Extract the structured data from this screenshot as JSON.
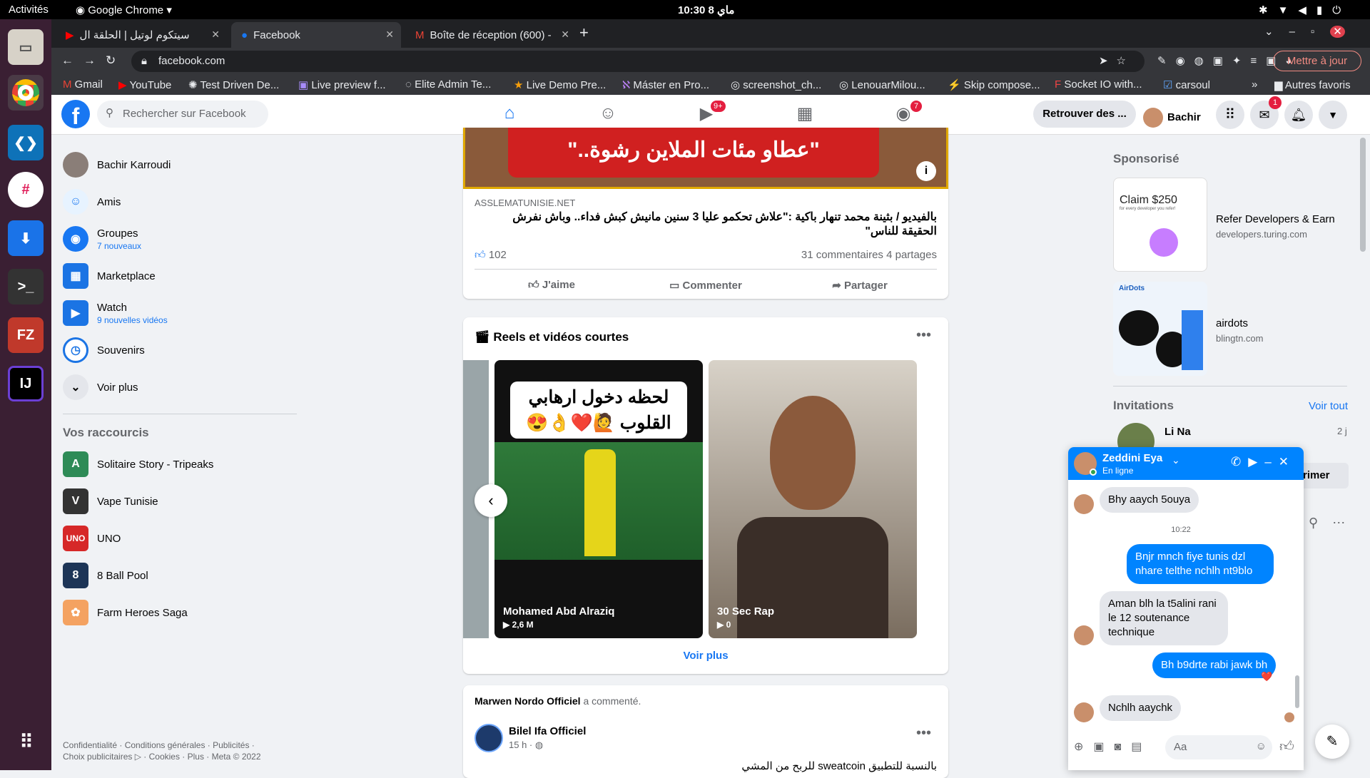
{
  "os": {
    "activities": "Activités",
    "app_name": "Google Chrome",
    "clock": "10:30  8 ماي"
  },
  "browser": {
    "tabs": [
      {
        "title": "سيتكوم لوتيل | الحلقة ال"
      },
      {
        "title": "Facebook"
      },
      {
        "title": "Boîte de réception (600) -"
      }
    ],
    "url": "facebook.com",
    "update_label": "Mettre à jour",
    "bookmarks": [
      "Gmail",
      "YouTube",
      "Test Driven De...",
      "Live preview f...",
      "Elite Admin Te...",
      "Live Demo Pre...",
      "Máster en Pro...",
      "screenshot_ch...",
      "LenouarMilou...",
      "Skip compose...",
      "Socket IO with...",
      "carsoul"
    ],
    "bookmarks_more": "»",
    "other_bookmarks": "Autres favoris"
  },
  "fb": {
    "search_placeholder": "Rechercher sur Facebook",
    "watch_badge": "9+",
    "groups_badge": "7",
    "messenger_badge": "1",
    "find_friends": "Retrouver des ...",
    "user_name": "Bachir",
    "left_nav": [
      {
        "label": "Bachir Karroudi",
        "sub": ""
      },
      {
        "label": "Amis",
        "sub": ""
      },
      {
        "label": "Groupes",
        "sub": "7 nouveaux"
      },
      {
        "label": "Marketplace",
        "sub": ""
      },
      {
        "label": "Watch",
        "sub": "9 nouvelles vidéos"
      },
      {
        "label": "Souvenirs",
        "sub": ""
      },
      {
        "label": "Voir plus",
        "sub": ""
      }
    ],
    "shortcuts_title": "Vos raccourcis",
    "shortcuts": [
      "Solitaire Story - Tripeaks",
      "Vape Tunisie",
      "UNO",
      "8 Ball Pool",
      "Farm Heroes Saga"
    ],
    "footer_line1": "Confidentialité · Conditions générales · Publicités ·",
    "footer_line2": "Choix publicitaires ▷ · Cookies · Plus · Meta © 2022",
    "post": {
      "image_text": "\"عطاو مئات الملاين رشوة..\"",
      "source": "ASSLEMATUNISIE.NET",
      "title": "بالفيديو / بثينة محمد تنهار باكية :\"علاش تحكمو عليا 3 سنين مانيش كبش فداء.. وباش نفرش الحقيقة للناس\"",
      "likes": "102",
      "comments": "31 commentaires",
      "shares": "4 partages",
      "like_label": "J'aime",
      "comment_label": "Commenter",
      "share_label": "Partager"
    },
    "reels": {
      "title": "Reels et vidéos courtes",
      "more_label": "Voir plus",
      "items": [
        {
          "overlay": "لحظه دخول ارهابي القلوب 🙋❤️👌😍",
          "author": "Mohamed Abd Alraziq",
          "views": "2,6 M"
        },
        {
          "overlay": "",
          "author": "30 Sec Rap",
          "views": "0"
        }
      ]
    },
    "activity": {
      "actor": "Marwen Nordo Officiel",
      "action": " a commenté.",
      "page": "Bilel Ifa Officiel",
      "time": "15 h ·",
      "snippet": "بالنسبة للتطبيق  sweatcoin  للربح من المشي"
    },
    "sponsored_title": "Sponsorisé",
    "ads": [
      {
        "title": "Refer Developers & Earn",
        "domain": "developers.turing.com",
        "image_text": "Claim $250",
        "image_sub": "for every developer you refer!"
      },
      {
        "title": "airdots",
        "domain": "blingtn.com",
        "image_text": "AirDots"
      }
    ],
    "invitations_title": "Invitations",
    "invitations_see_all": "Voir tout",
    "invitation": {
      "name": "Li Na",
      "time": "2 j",
      "button_label": "rimer"
    },
    "chat": {
      "name": "Zeddini Eya",
      "status": "En ligne",
      "input_placeholder": "Aa",
      "time_divider": "10:22",
      "messages": [
        {
          "dir": "in",
          "text": "Bhy aaych 5ouya"
        },
        {
          "dir": "out",
          "text": "Bnjr mnch fiye tunis dzl nhare telthe nchlh nt9blo"
        },
        {
          "dir": "in",
          "text": "Aman blh la t5alini rani le 12 soutenance technique"
        },
        {
          "dir": "out",
          "text": "Bh b9drte rabi jawk bh"
        },
        {
          "dir": "in",
          "text": "Nchlh aaychk"
        }
      ],
      "reaction": "❤️"
    }
  },
  "colors": {
    "fb_blue": "#1877f2",
    "messenger_blue": "#0084ff",
    "badge_red": "#e41e3f",
    "dock_bg": "#3a1f33"
  }
}
